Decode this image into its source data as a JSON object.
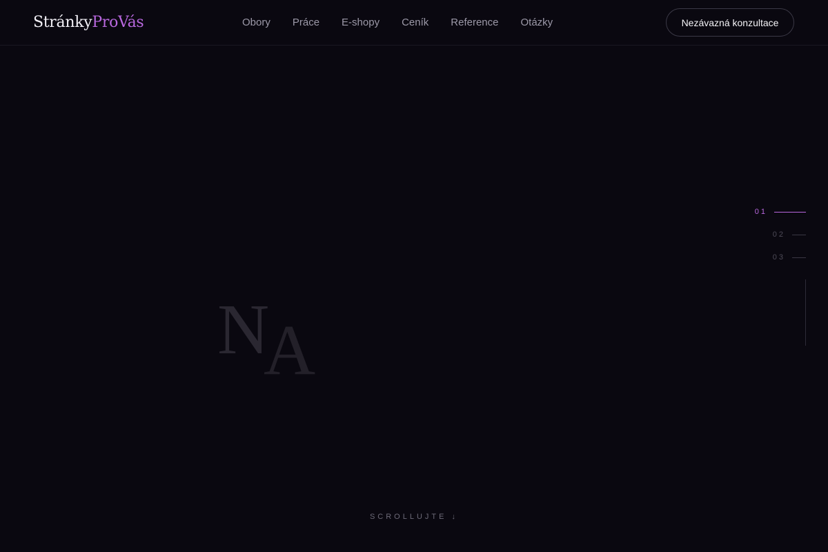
{
  "logo": {
    "part1": "Stránky",
    "part2": "ProVás"
  },
  "nav": [
    {
      "label": "Obory"
    },
    {
      "label": "Práce"
    },
    {
      "label": "E-shopy"
    },
    {
      "label": "Ceník"
    },
    {
      "label": "Reference"
    },
    {
      "label": "Otázky"
    }
  ],
  "cta": {
    "label": "Nezávazná konzultace"
  },
  "hero": {
    "letters": [
      "N",
      "A"
    ]
  },
  "sections": [
    {
      "num": "01",
      "active": true
    },
    {
      "num": "02",
      "active": false
    },
    {
      "num": "03",
      "active": false
    }
  ],
  "scroll_hint": {
    "label": "SCROLLUJTE",
    "arrow": "↓"
  },
  "colors": {
    "background": "#0a0810",
    "accent": "#b968df",
    "muted_text": "#9c99a8"
  }
}
